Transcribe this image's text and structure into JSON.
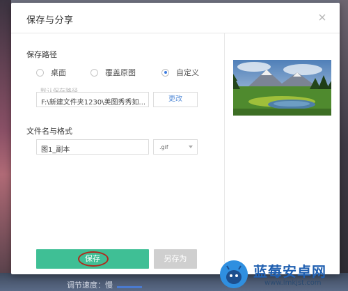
{
  "dialog": {
    "title": "保存与分享",
    "close_glyph": "×"
  },
  "save_path": {
    "label": "保存路径",
    "options": [
      "桌面",
      "覆盖原图",
      "自定义"
    ],
    "selected": "自定义",
    "hint": "默认保存路径",
    "path_value": "F:\\新建文件夹1230\\美图秀秀如...",
    "change_label": "更改"
  },
  "file": {
    "label": "文件名与格式",
    "name_value": "图1_副本",
    "format_value": ".gif"
  },
  "actions": {
    "save_label": "保存",
    "save_as_label": "另存为"
  },
  "colors": {
    "accent_green": "#3fbf95",
    "disabled_gray": "#cfcfcf",
    "radio_selected": "#3d7ce0",
    "annotation_red": "#b02a1c"
  },
  "background": {
    "bottom_text": "调节速度：慢"
  },
  "watermark": {
    "title": "蓝莓安卓网",
    "url": "www.lmkjst.com"
  }
}
